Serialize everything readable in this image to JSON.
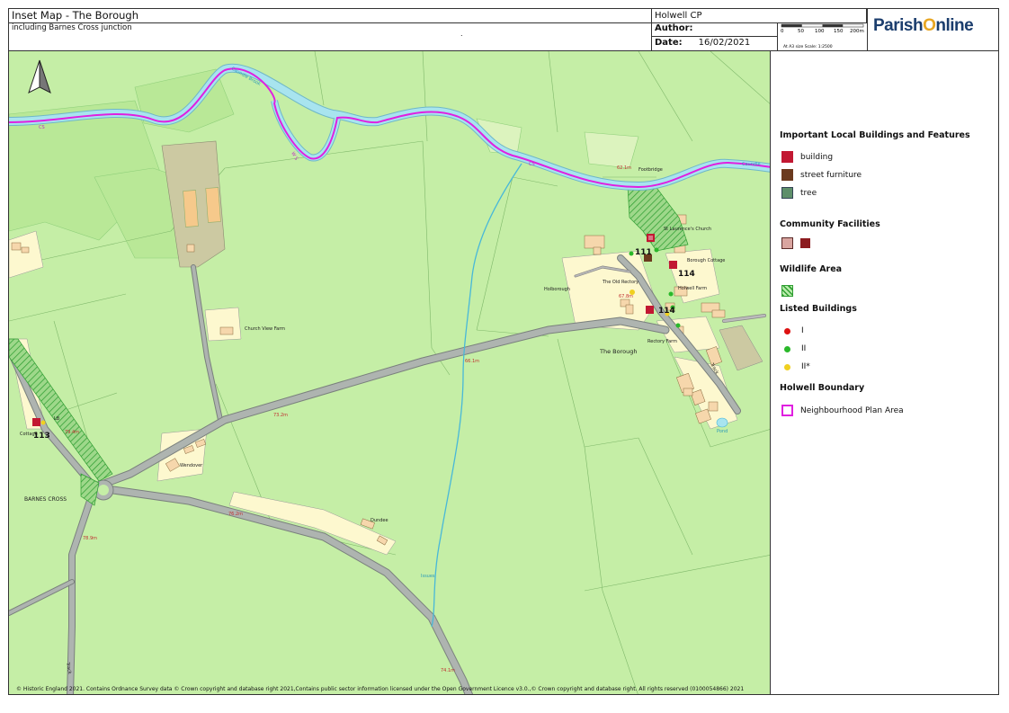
{
  "header": {
    "title": "Inset Map - The Borough",
    "subtitle": "including Barnes Cross junction",
    "dot": ".",
    "parish": "Holwell CP",
    "author_label": "Author:",
    "date_label": "Date:",
    "date_value": "16/02/2021",
    "scale_ticks": [
      "0",
      "50",
      "100",
      "150",
      "200m"
    ],
    "scale_note": "At A3 size  Scale: 1:2500",
    "logo_part1": "Parish",
    "logo_o": "O",
    "logo_part2": "nline"
  },
  "legend": {
    "section1": "Important Local Buildings and Features",
    "building": "building",
    "street_furniture": "street furniture",
    "tree": "tree",
    "section2": "Community Facilities",
    "section3": "Wildlife Area",
    "section4": "Listed Buildings",
    "grade_i": "I",
    "grade_ii": "II",
    "grade_iistar": "II*",
    "section5": "Holwell Boundary",
    "boundary": "Neighbourhood Plan Area"
  },
  "colors": {
    "field": "#c5eea6",
    "field_dark": "#b8e896",
    "river": "#a8e4ef",
    "road": "#aeb4b0",
    "boundary": "#e020e0",
    "building": "#f6d7ac",
    "residential": "#fdf8cf",
    "icon_red": "#c21832",
    "icon_brown": "#6b3a1e"
  },
  "map_labels": {
    "cs1": "CS",
    "cs2": "CS",
    "caundle_brook_1": "Caundle Brook",
    "caundle_brook_2": "Caundle",
    "footbridge": "Footbridge",
    "h62": "62.1m",
    "st_laurence": "St Laurence's Church",
    "n111": "111",
    "n114a": "114",
    "n114b": "114",
    "n113": "113",
    "borough_cottage": "Borough Cottage",
    "holwell_farm": "Holwell Farm",
    "holborough": "Holborough",
    "old_rectory": "The Old Rectory",
    "h67": "67.8m",
    "rectory_farm": "Rectory Farm",
    "the_borough": "The Borough",
    "h66": "66.1m",
    "h73": "73.2m",
    "church_view_farm": "Church View Farm",
    "wendover": "Wendover",
    "dundee": "Dundee",
    "h76": "76.2m",
    "h78": "78.9m",
    "h79": "79.4m",
    "lb": "LB",
    "cottage": "Cottage",
    "barnes_cross": "BARNES CROSS",
    "issues": "Issues",
    "track1": "Track",
    "track2": "Track",
    "pond": "Pond",
    "h74": "74.1m",
    "ws": "W S"
  },
  "copyright": "© Historic England 2021. Contains Ordnance Survey data © Crown copyright and database right 2021,Contains public sector information licensed under the Open Government Licence v3.0.,© Crown copyright and database right. All rights reserved (0100054866) 2021"
}
